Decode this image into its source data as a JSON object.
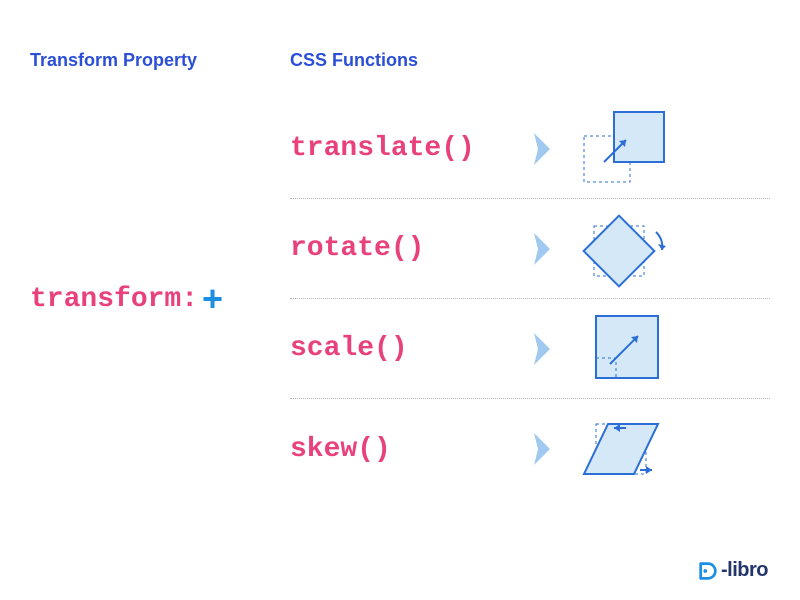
{
  "headings": {
    "left": "Transform Property",
    "right": "CSS Functions"
  },
  "property": {
    "text": "transform:",
    "plus": "+"
  },
  "functions": [
    {
      "label": "translate()"
    },
    {
      "label": "rotate()"
    },
    {
      "label": "scale()"
    },
    {
      "label": "skew()"
    }
  ],
  "logo": {
    "text": "-libro"
  },
  "colors": {
    "heading": "#2b4fd6",
    "code": "#e8417c",
    "plus": "#1a8fe3",
    "shapeFill": "#d5e8f7",
    "shapeStroke": "#2b6fd6",
    "arrowFill": "#9fc9ef"
  }
}
